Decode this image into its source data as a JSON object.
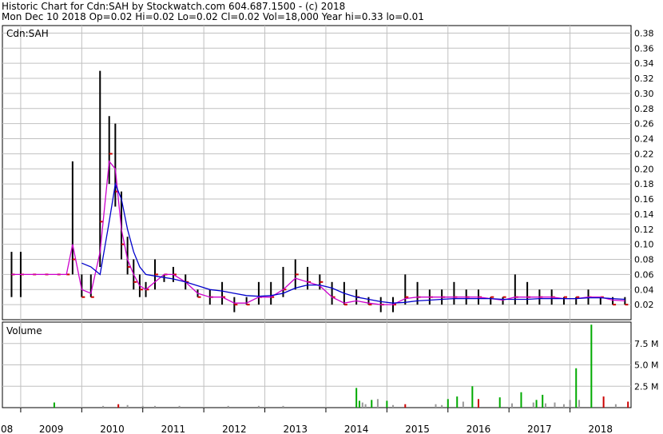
{
  "header": {
    "line1": "Historic Chart for Cdn:SAH by Stockwatch.com 604.687.1500 - (c) 2018",
    "line2": "Mon Dec 10 2018  Op=0.02  Hi=0.02  Lo=0.02  Cl=0.02  Vol=18,000  Year hi=0.33  lo=0.01"
  },
  "chart_data": [
    {
      "type": "line",
      "panel": "price",
      "title": "Cdn:SAH",
      "ylim": [
        0,
        0.39
      ],
      "yticks": [
        "0.02",
        "0.04",
        "0.06",
        "0.08",
        "0.10",
        "0.12",
        "0.14",
        "0.16",
        "0.18",
        "0.20",
        "0.22",
        "0.24",
        "0.26",
        "0.28",
        "0.30",
        "0.32",
        "0.34",
        "0.36",
        "0.38"
      ],
      "grid": true,
      "x_labels": [
        "08",
        "2009",
        "2010",
        "2011",
        "2012",
        "2013",
        "2014",
        "2015",
        "2016",
        "2017",
        "2018"
      ],
      "colors": {
        "price_bar": "#000000",
        "close_mark": "#cc0000",
        "ma_short": "#cc00cc",
        "ma_long": "#0000cc",
        "grid": "#c0c0c0"
      },
      "x": [
        2008.85,
        2009.0,
        2009.2,
        2009.4,
        2009.6,
        2009.75,
        2009.85,
        2010.0,
        2010.15,
        2010.3,
        2010.45,
        2010.55,
        2010.65,
        2010.75,
        2010.85,
        2010.95,
        2011.05,
        2011.2,
        2011.35,
        2011.5,
        2011.7,
        2011.9,
        2012.1,
        2012.3,
        2012.5,
        2012.7,
        2012.9,
        2013.1,
        2013.3,
        2013.5,
        2013.7,
        2013.9,
        2014.1,
        2014.3,
        2014.5,
        2014.7,
        2014.9,
        2015.1,
        2015.3,
        2015.5,
        2015.7,
        2015.9,
        2016.1,
        2016.3,
        2016.5,
        2016.7,
        2016.9,
        2017.1,
        2017.3,
        2017.5,
        2017.7,
        2017.9,
        2018.1,
        2018.3,
        2018.5,
        2018.7,
        2018.9
      ],
      "series": [
        {
          "name": "price",
          "high": [
            0.09,
            0.09,
            0.06,
            0.06,
            0.06,
            0.06,
            0.21,
            0.06,
            0.06,
            0.33,
            0.27,
            0.26,
            0.17,
            0.11,
            0.08,
            0.06,
            0.05,
            0.08,
            0.06,
            0.07,
            0.06,
            0.04,
            0.04,
            0.05,
            0.03,
            0.03,
            0.05,
            0.05,
            0.07,
            0.08,
            0.07,
            0.06,
            0.05,
            0.05,
            0.04,
            0.03,
            0.03,
            0.03,
            0.06,
            0.05,
            0.04,
            0.04,
            0.05,
            0.04,
            0.04,
            0.03,
            0.03,
            0.06,
            0.05,
            0.04,
            0.04,
            0.03,
            0.03,
            0.04,
            0.03,
            0.03,
            0.03
          ],
          "low": [
            0.03,
            0.03,
            0.06,
            0.06,
            0.06,
            0.06,
            0.06,
            0.03,
            0.03,
            0.07,
            0.18,
            0.15,
            0.08,
            0.06,
            0.04,
            0.03,
            0.03,
            0.04,
            0.05,
            0.05,
            0.04,
            0.03,
            0.02,
            0.02,
            0.01,
            0.02,
            0.02,
            0.02,
            0.03,
            0.04,
            0.04,
            0.04,
            0.02,
            0.02,
            0.02,
            0.02,
            0.01,
            0.01,
            0.02,
            0.02,
            0.02,
            0.02,
            0.02,
            0.02,
            0.02,
            0.02,
            0.02,
            0.02,
            0.02,
            0.02,
            0.02,
            0.02,
            0.02,
            0.02,
            0.02,
            0.02,
            0.02
          ],
          "close": [
            0.06,
            0.06,
            0.06,
            0.06,
            0.06,
            0.06,
            0.08,
            0.03,
            0.03,
            0.13,
            0.22,
            0.17,
            0.1,
            0.07,
            0.05,
            0.04,
            0.04,
            0.06,
            0.06,
            0.06,
            0.05,
            0.03,
            0.03,
            0.03,
            0.02,
            0.02,
            0.03,
            0.03,
            0.04,
            0.06,
            0.05,
            0.05,
            0.03,
            0.02,
            0.03,
            0.02,
            0.02,
            0.02,
            0.03,
            0.03,
            0.03,
            0.03,
            0.03,
            0.03,
            0.03,
            0.03,
            0.03,
            0.03,
            0.03,
            0.03,
            0.03,
            0.03,
            0.03,
            0.03,
            0.03,
            0.02,
            0.02
          ]
        },
        {
          "name": "ma_short",
          "values": [
            0.06,
            0.06,
            0.06,
            0.06,
            0.06,
            0.06,
            0.1,
            0.04,
            0.035,
            0.09,
            0.21,
            0.2,
            0.12,
            0.08,
            0.06,
            0.045,
            0.04,
            0.05,
            0.06,
            0.06,
            0.05,
            0.035,
            0.03,
            0.03,
            0.022,
            0.022,
            0.03,
            0.03,
            0.04,
            0.055,
            0.05,
            0.045,
            0.03,
            0.022,
            0.025,
            0.022,
            0.02,
            0.02,
            0.028,
            0.03,
            0.03,
            0.03,
            0.03,
            0.03,
            0.03,
            0.028,
            0.026,
            0.03,
            0.03,
            0.03,
            0.03,
            0.028,
            0.028,
            0.03,
            0.03,
            0.026,
            0.025
          ]
        },
        {
          "name": "ma_long",
          "values": [
            null,
            null,
            null,
            null,
            null,
            null,
            null,
            0.075,
            0.07,
            0.06,
            0.13,
            0.18,
            0.16,
            0.12,
            0.09,
            0.07,
            0.06,
            0.058,
            0.056,
            0.054,
            0.05,
            0.045,
            0.04,
            0.038,
            0.035,
            0.032,
            0.031,
            0.032,
            0.035,
            0.042,
            0.046,
            0.046,
            0.042,
            0.035,
            0.03,
            0.027,
            0.024,
            0.022,
            0.023,
            0.025,
            0.026,
            0.027,
            0.028,
            0.028,
            0.028,
            0.028,
            0.027,
            0.027,
            0.027,
            0.028,
            0.028,
            0.028,
            0.028,
            0.029,
            0.029,
            0.028,
            0.027
          ]
        }
      ]
    },
    {
      "type": "bar",
      "panel": "volume",
      "title": "Volume",
      "ylim": [
        0,
        10
      ],
      "yticks": [
        "2.5 M",
        "5.0 M",
        "7.5 M"
      ],
      "unit": "M",
      "x": [
        2009.55,
        2010.35,
        2010.6,
        2010.75,
        2011.0,
        2011.2,
        2011.6,
        2012.4,
        2012.9,
        2013.3,
        2014.5,
        2014.55,
        2014.6,
        2014.65,
        2014.75,
        2014.85,
        2015.0,
        2015.1,
        2015.3,
        2015.8,
        2015.9,
        2016.0,
        2016.15,
        2016.25,
        2016.4,
        2016.5,
        2016.85,
        2017.05,
        2017.2,
        2017.4,
        2017.45,
        2017.55,
        2017.6,
        2017.75,
        2017.9,
        2018.0,
        2018.1,
        2018.15,
        2018.35,
        2018.55,
        2018.75,
        2018.95
      ],
      "values": [
        0.6,
        0.2,
        0.4,
        0.3,
        0.2,
        0.2,
        0.2,
        0.2,
        0.2,
        0.2,
        2.3,
        0.8,
        0.6,
        0.4,
        0.9,
        1.0,
        0.8,
        0.3,
        0.4,
        0.4,
        0.3,
        1.0,
        1.3,
        0.7,
        2.5,
        1.0,
        1.2,
        0.5,
        1.8,
        0.6,
        0.9,
        1.5,
        0.5,
        0.6,
        0.4,
        0.9,
        4.6,
        0.9,
        9.7,
        1.3,
        0.4,
        0.7
      ],
      "colors": {
        "up": "#00aa00",
        "down": "#cc0000",
        "neutral": "#999999"
      },
      "bar_colors": [
        "up",
        "neutral",
        "down",
        "neutral",
        "neutral",
        "neutral",
        "neutral",
        "neutral",
        "neutral",
        "neutral",
        "up",
        "up",
        "neutral",
        "neutral",
        "up",
        "neutral",
        "up",
        "neutral",
        "down",
        "neutral",
        "neutral",
        "up",
        "up",
        "neutral",
        "up",
        "down",
        "up",
        "neutral",
        "up",
        "neutral",
        "up",
        "up",
        "neutral",
        "neutral",
        "neutral",
        "neutral",
        "up",
        "neutral",
        "up",
        "down",
        "neutral",
        "down"
      ]
    }
  ]
}
